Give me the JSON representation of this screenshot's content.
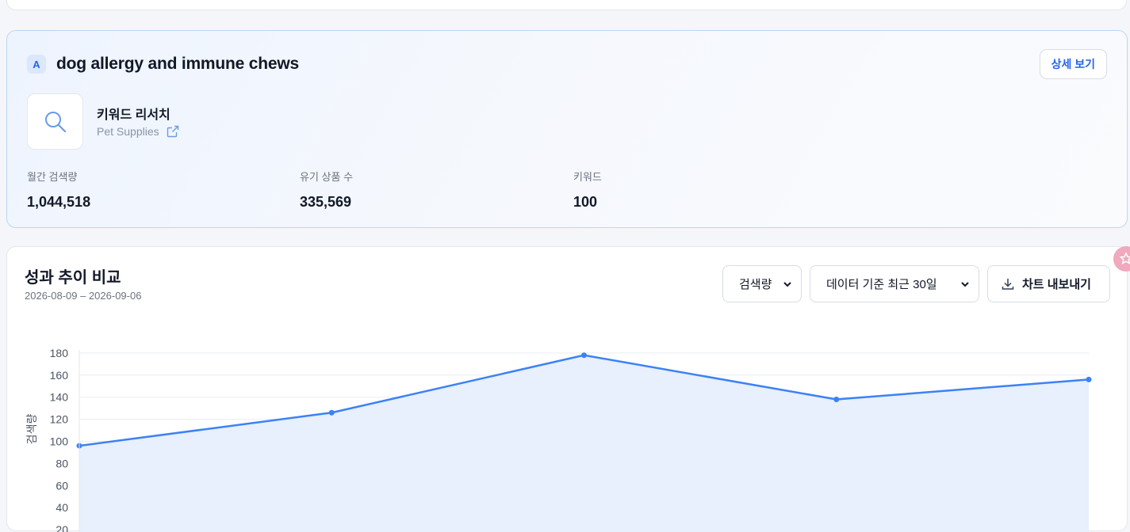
{
  "keyword_card": {
    "badge": "A",
    "title": "dog allergy and immune chews",
    "detail_button": "상세 보기",
    "thumbnail_icon": "search-icon",
    "research_label": "키워드 리서치",
    "category": "Pet Supplies",
    "category_link_icon": "external-link-icon",
    "stats": [
      {
        "label": "월간 검색량",
        "value": "1,044,518"
      },
      {
        "label": "유기 상품 수",
        "value": "335,569"
      },
      {
        "label": "키워드",
        "value": "100"
      }
    ]
  },
  "chart_section": {
    "title": "성과 추이 비교",
    "date_range": "2026-08-09 – 2026-09-06",
    "metric_select": "검색량",
    "period_select": "데이터 기준 최근 30일",
    "export_button": "차트 내보내기",
    "export_icon": "download-icon"
  },
  "chart_data": {
    "type": "area",
    "ylabel": "검색량",
    "yticks": [
      20,
      40,
      60,
      80,
      100,
      120,
      140,
      160,
      180
    ],
    "ylim": [
      0,
      180
    ],
    "series": [
      {
        "values": [
          96,
          126,
          178,
          138,
          156
        ]
      }
    ],
    "grid": true,
    "colors": {
      "line": "#3b82f6",
      "fill": "#e8effd",
      "grid": "#e9edf2"
    }
  },
  "floating_icon": "star-icon"
}
